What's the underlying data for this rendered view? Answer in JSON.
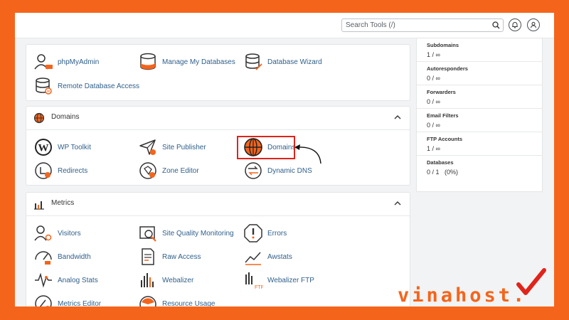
{
  "search": {
    "placeholder": "Search Tools (/)"
  },
  "header_icons": [
    "bell-icon",
    "user-icon"
  ],
  "databases": {
    "items": [
      {
        "label": "phpMyAdmin",
        "icon": "phpmyadmin-icon"
      },
      {
        "label": "Manage My Databases",
        "icon": "database-icon"
      },
      {
        "label": "Database Wizard",
        "icon": "database-wizard-icon"
      },
      {
        "label": "Remote Database Access",
        "icon": "remote-database-icon"
      }
    ]
  },
  "domains": {
    "title": "Domains",
    "items": [
      {
        "label": "WP Toolkit",
        "icon": "wordpress-icon"
      },
      {
        "label": "Site Publisher",
        "icon": "paper-plane-icon"
      },
      {
        "label": "Domains",
        "icon": "globe-icon"
      },
      {
        "label": "Redirects",
        "icon": "redirect-icon"
      },
      {
        "label": "Zone Editor",
        "icon": "zone-editor-icon"
      },
      {
        "label": "Dynamic DNS",
        "icon": "dynamic-dns-icon"
      }
    ]
  },
  "metrics": {
    "title": "Metrics",
    "items": [
      {
        "label": "Visitors",
        "icon": "visitors-icon"
      },
      {
        "label": "Site Quality Monitoring",
        "icon": "site-quality-icon"
      },
      {
        "label": "Errors",
        "icon": "errors-icon"
      },
      {
        "label": "Bandwidth",
        "icon": "bandwidth-icon"
      },
      {
        "label": "Raw Access",
        "icon": "raw-access-icon"
      },
      {
        "label": "Awstats",
        "icon": "awstats-icon"
      },
      {
        "label": "Analog Stats",
        "icon": "analog-stats-icon"
      },
      {
        "label": "Webalizer",
        "icon": "webalizer-icon"
      },
      {
        "label": "Webalizer FTP",
        "icon": "webalizer-ftp-icon"
      },
      {
        "label": "Metrics Editor",
        "icon": "metrics-editor-icon"
      },
      {
        "label": "Resource Usage",
        "icon": "resource-usage-icon"
      }
    ]
  },
  "stats": [
    {
      "label": "Subdomains",
      "value": "1 / ∞"
    },
    {
      "label": "Autoresponders",
      "value": "0 / ∞"
    },
    {
      "label": "Forwarders",
      "value": "0 / ∞"
    },
    {
      "label": "Email Filters",
      "value": "0 / ∞"
    },
    {
      "label": "FTP Accounts",
      "value": "1 / ∞"
    },
    {
      "label": "Databases",
      "value": "0 / 1   (0%)"
    }
  ],
  "logo": {
    "text": "vinahost."
  },
  "colors": {
    "accent": "#f5641b",
    "link": "#2f5f8a",
    "highlight": "#e0231b"
  }
}
